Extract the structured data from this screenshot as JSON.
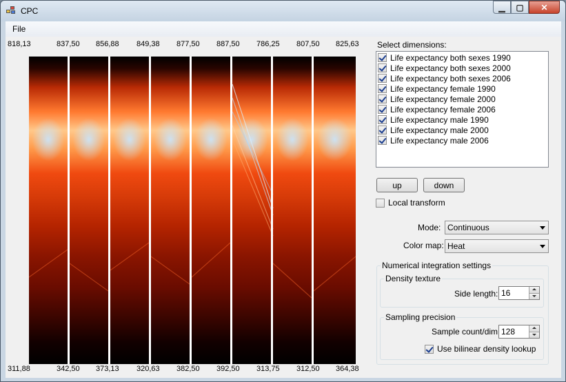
{
  "window": {
    "title": "CPC",
    "minimize_label": "▁",
    "maximize_label": "▢",
    "close_label": "✕"
  },
  "menu": {
    "file": "File"
  },
  "axes": {
    "top": [
      "818,13",
      "837,50",
      "856,88",
      "849,38",
      "877,50",
      "887,50",
      "786,25",
      "807,50",
      "825,63"
    ],
    "bottom": [
      "311,88",
      "342,50",
      "373,13",
      "320,63",
      "382,50",
      "392,50",
      "313,75",
      "312,50",
      "364,38"
    ]
  },
  "dimensions": {
    "label": "Select dimensions:",
    "items": [
      {
        "label": "Life expectancy both sexes 1990",
        "checked": true
      },
      {
        "label": "Life expectancy both sexes 2000",
        "checked": true
      },
      {
        "label": "Life expectancy both sexes 2006",
        "checked": true
      },
      {
        "label": "Life expectancy female 1990",
        "checked": true
      },
      {
        "label": "Life expectancy female 2000",
        "checked": true
      },
      {
        "label": "Life expectancy female 2006",
        "checked": true
      },
      {
        "label": "Life expectancy male 1990",
        "checked": true
      },
      {
        "label": "Life expectancy male 2000",
        "checked": true
      },
      {
        "label": "Life expectancy male 2006",
        "checked": true
      }
    ]
  },
  "buttons": {
    "up": "up",
    "down": "down"
  },
  "local_transform": {
    "label": "Local transform",
    "checked": false
  },
  "mode": {
    "label": "Mode:",
    "value": "Continuous"
  },
  "colormap": {
    "label": "Color map:",
    "value": "Heat"
  },
  "numerical": {
    "title": "Numerical integration settings",
    "density": {
      "title": "Density texture",
      "side_length_label": "Side length:",
      "side_length_value": "16"
    },
    "sampling": {
      "title": "Sampling precision",
      "sample_count_label": "Sample count/dim:",
      "sample_count_value": "128"
    },
    "bilinear": {
      "label": "Use bilinear density lookup",
      "checked": true
    }
  }
}
